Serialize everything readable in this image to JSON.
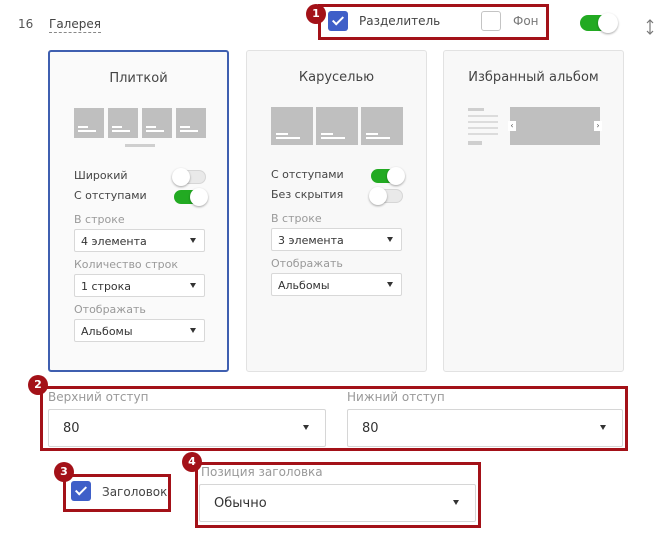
{
  "block": {
    "number": "16",
    "title": "Галерея"
  },
  "top_options": {
    "divider_label": "Разделитель",
    "divider_checked": true,
    "background_label": "Фон",
    "background_checked": false,
    "block_enabled": true
  },
  "cards": [
    {
      "title": "Плиткой",
      "options": [
        {
          "label": "Широкий",
          "on": false
        },
        {
          "label": "С отступами",
          "on": true
        }
      ],
      "fields": [
        {
          "label": "В строке",
          "value": "4 элемента"
        },
        {
          "label": "Количество строк",
          "value": "1 строка"
        },
        {
          "label": "Отображать",
          "value": "Альбомы"
        }
      ]
    },
    {
      "title": "Каруселью",
      "options": [
        {
          "label": "С отступами",
          "on": true
        },
        {
          "label": "Без скрытия",
          "on": false
        }
      ],
      "fields": [
        {
          "label": "В строке",
          "value": "3 элемента"
        },
        {
          "label": "Отображать",
          "value": "Альбомы"
        }
      ]
    },
    {
      "title": "Избранный альбом"
    }
  ],
  "spacing": {
    "top": {
      "label": "Верхний отступ",
      "value": "80"
    },
    "bottom": {
      "label": "Нижний отступ",
      "value": "80"
    }
  },
  "heading": {
    "label": "Заголовок",
    "checked": true
  },
  "heading_position": {
    "label": "Позиция заголовка",
    "value": "Обычно"
  },
  "badges": [
    "1",
    "2",
    "3",
    "4"
  ],
  "colors": {
    "accent": "#3f5fc8",
    "toggle_on": "#22aa22",
    "annotation": "#a31118"
  }
}
